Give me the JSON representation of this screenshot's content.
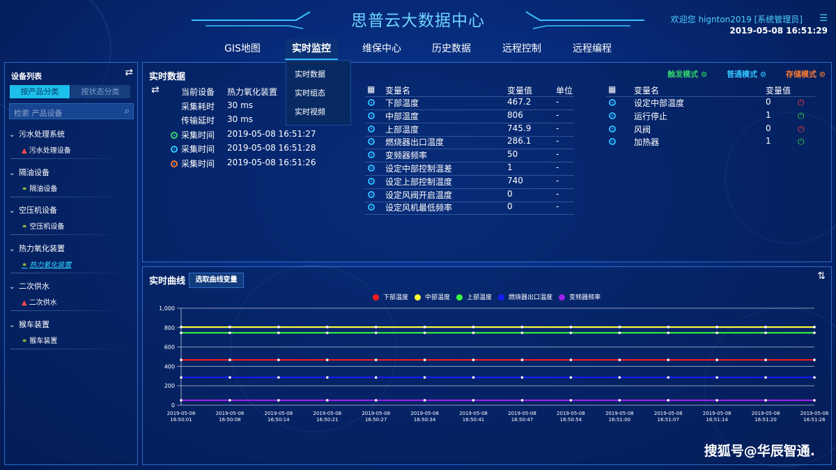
{
  "header": {
    "title": "思普云大数据中心",
    "welcome": "欢迎您  hignton2019 [系统管理员]",
    "datetime": "2019-05-08 16:51:29"
  },
  "nav": {
    "items": [
      "GIS地图",
      "实时监控",
      "维保中心",
      "历史数据",
      "远程控制",
      "远程编程"
    ],
    "active": "实时监控",
    "dropdown": [
      "实时数据",
      "实时组态",
      "实时视频"
    ]
  },
  "sidebar": {
    "title": "设备列表",
    "tab_product": "按产品分类",
    "tab_status": "按状态分类",
    "search_placeholder": "检索 产品设备",
    "groups": [
      {
        "name": "污水处理系统",
        "child": "污水处理设备",
        "child_icon": "warning-icon"
      },
      {
        "name": "隔油设备",
        "child": "隔油设备",
        "child_icon": "link-icon"
      },
      {
        "name": "空压机设备",
        "child": "空压机设备",
        "child_icon": "link-icon"
      },
      {
        "name": "热力氧化装置",
        "child": "热力氧化装置",
        "child_icon": "link-icon",
        "selected": true
      },
      {
        "name": "二次供水",
        "child": "二次供水",
        "child_icon": "warning-icon"
      },
      {
        "name": "猴车装置",
        "child": "猴车装置",
        "child_icon": "link-icon"
      }
    ]
  },
  "realtime": {
    "title": "实时数据",
    "modes": [
      {
        "label": "触发模式",
        "color": "#34d36a"
      },
      {
        "label": "普通模式",
        "color": "#33c6ff"
      },
      {
        "label": "存储模式",
        "color": "#ff7b2e"
      }
    ],
    "info": [
      {
        "label": "当前设备",
        "value": "热力氧化装置",
        "icon": ""
      },
      {
        "label": "采集耗时",
        "value": "30 ms",
        "icon": ""
      },
      {
        "label": "传输延时",
        "value": "30 ms",
        "icon": ""
      },
      {
        "label": "采集时间",
        "value": "2019-05-08 16:51:27",
        "icon_color": "#34d36a"
      },
      {
        "label": "采集时间",
        "value": "2019-05-08 16:51:28",
        "icon_color": "#33c6ff"
      },
      {
        "label": "采集时间",
        "value": "2019-05-08 16:51:26",
        "icon_color": "#ff7b2e"
      }
    ],
    "table1": {
      "headers": [
        "变量名",
        "变量值",
        "单位"
      ],
      "rows": [
        [
          "下部温度",
          "467.2",
          "-"
        ],
        [
          "中部温度",
          "806",
          "-"
        ],
        [
          "上部温度",
          "745.9",
          "-"
        ],
        [
          "燃烧器出口温度",
          "286.1",
          "-"
        ],
        [
          "变频器频率",
          "50",
          "-"
        ],
        [
          "设定中部控制温差",
          "1",
          "-"
        ],
        [
          "设定上部控制温度",
          "740",
          "-"
        ],
        [
          "设定风阀开启温度",
          "0",
          "-"
        ],
        [
          "设定风机最低频率",
          "0",
          "-"
        ]
      ]
    },
    "table2": {
      "headers": [
        "变量名",
        "变量值"
      ],
      "rows": [
        [
          "设定中部温度",
          "0",
          "#ff3b3b"
        ],
        [
          "运行停止",
          "1",
          "#35d23a"
        ],
        [
          "风阀",
          "0",
          "#ff3b3b"
        ],
        [
          "加热器",
          "1",
          "#35d23a"
        ]
      ]
    }
  },
  "curve": {
    "title": "实时曲线",
    "select_button": "选取曲线变量"
  },
  "chart_data": {
    "type": "line",
    "x": [
      "2019-05-08 16:50:01",
      "2019-05-08 16:50:08",
      "2019-05-08 16:50:14",
      "2019-05-08 16:50:21",
      "2019-05-08 16:50:27",
      "2019-05-08 16:50:34",
      "2019-05-08 16:50:41",
      "2019-05-08 16:50:47",
      "2019-05-08 16:50:54",
      "2019-05-08 16:51:00",
      "2019-05-08 16:51:07",
      "2019-05-08 16:51:14",
      "2019-05-08 16:51:20",
      "2019-05-08 16:51:26"
    ],
    "yticks": [
      "0",
      "200",
      "400",
      "600",
      "800",
      "1,000"
    ],
    "ylim": [
      0,
      1000
    ],
    "grid": true,
    "series": [
      {
        "name": "下部温度",
        "color": "#ff1a1a",
        "values": [
          467,
          467,
          467,
          467,
          467,
          467,
          467,
          467,
          467,
          467,
          467,
          467,
          467,
          467
        ]
      },
      {
        "name": "中部温度",
        "color": "#ffff33",
        "values": [
          806,
          806,
          806,
          806,
          806,
          806,
          806,
          806,
          806,
          806,
          806,
          806,
          806,
          806
        ]
      },
      {
        "name": "上部温度",
        "color": "#39ff3a",
        "values": [
          746,
          746,
          746,
          746,
          746,
          746,
          746,
          746,
          746,
          746,
          746,
          746,
          746,
          746
        ]
      },
      {
        "name": "燃烧器出口温度",
        "color": "#1a1aff",
        "values": [
          286,
          286,
          286,
          286,
          286,
          286,
          286,
          286,
          286,
          286,
          286,
          286,
          286,
          286
        ]
      },
      {
        "name": "变频器频率",
        "color": "#a020f0",
        "values": [
          50,
          50,
          50,
          50,
          50,
          50,
          50,
          50,
          50,
          50,
          50,
          50,
          50,
          50
        ]
      }
    ]
  },
  "watermark": "搜狐号@华辰智通."
}
